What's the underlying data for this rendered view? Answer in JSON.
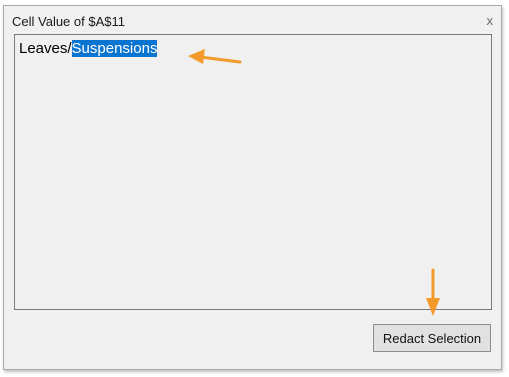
{
  "window": {
    "title": "Cell Value of $A$11",
    "close_glyph": "x"
  },
  "editor": {
    "text_before_selection": "Leaves/",
    "selected_text": "Suspensions"
  },
  "actions": {
    "redact_label": "Redact Selection"
  },
  "colors": {
    "selection": "#0a74d1",
    "annotation_arrow": "#f39a2b",
    "dialog_background": "#f0f0f0"
  }
}
